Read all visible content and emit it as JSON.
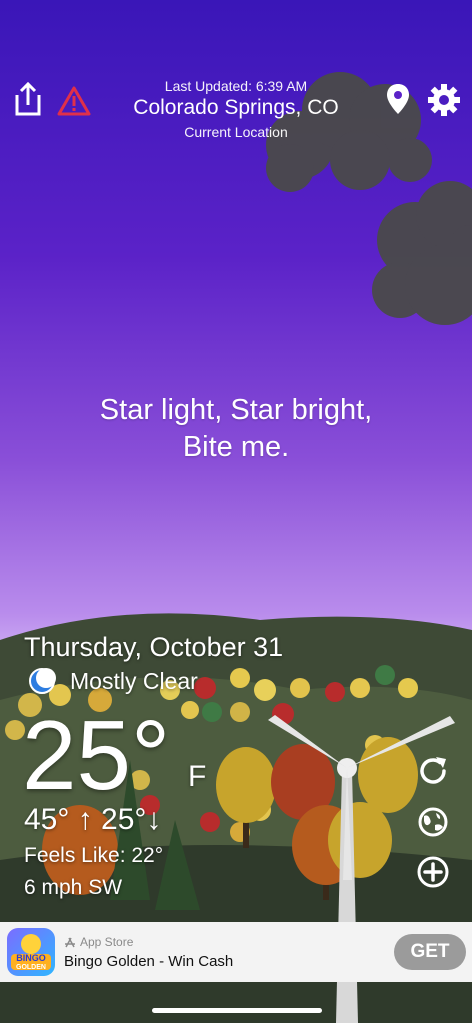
{
  "header": {
    "last_updated": "Last Updated: 6:39 AM",
    "city": "Colorado Springs, CO",
    "location_label": "Current Location"
  },
  "quip": {
    "line1": "Star light, Star bright,",
    "line2": "Bite me."
  },
  "weather": {
    "date": "Thursday, October 31",
    "condition": "Mostly Clear",
    "temperature": "25°",
    "unit": "F",
    "high": "45°",
    "low": "25°",
    "feels_like": "Feels Like: 22°",
    "wind": "6 mph SW"
  },
  "ad": {
    "store_label": "App Store",
    "title": "Bingo Golden - Win Cash",
    "button": "GET",
    "icon_text_top": "BINGO",
    "icon_text_bottom": "GOLDEN"
  },
  "icons": [
    "share-icon",
    "warning-icon",
    "location-pin-icon",
    "settings-gear-icon",
    "moon-icon",
    "refresh-icon",
    "radar-icon",
    "add-icon"
  ]
}
